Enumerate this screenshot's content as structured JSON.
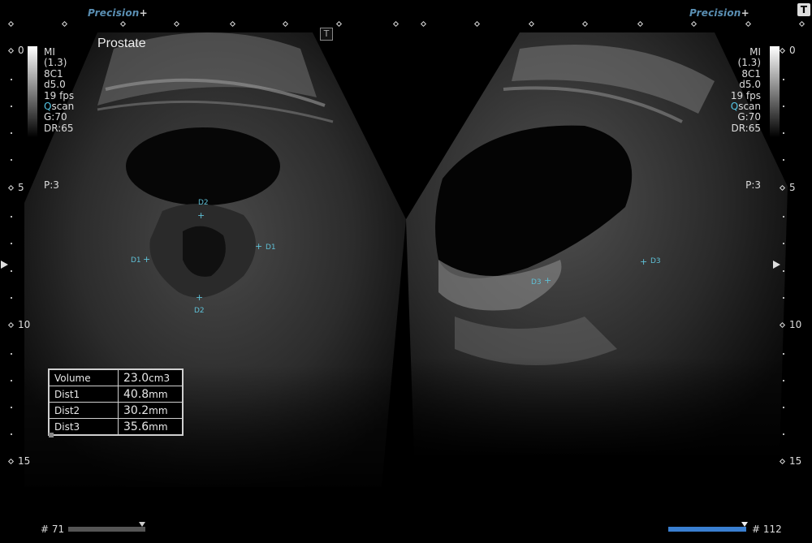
{
  "brand": {
    "left": "Precision",
    "right": "Precision",
    "plus": "+"
  },
  "exam_label": "Prostate",
  "t_icon": "T",
  "params_left": {
    "mi": "MI",
    "mi_val": "(1.3)",
    "probe": "8C1",
    "depth": "d5.0",
    "fps": "19 fps",
    "q": "Q",
    "scan": "scan",
    "gain": "G:70",
    "dr": "DR:65",
    "p": "P:3"
  },
  "params_right": {
    "mi": "MI",
    "mi_val": "(1.3)",
    "probe": "8C1",
    "depth": "d5.0",
    "fps": "19 fps",
    "q": "Q",
    "scan": "scan",
    "gain": "G:70",
    "dr": "DR:65",
    "p": "P:3"
  },
  "depth_scale": {
    "d0": "0",
    "d5": "5",
    "d10": "10",
    "d15": "15"
  },
  "calipers": {
    "d1": "D1",
    "d2": "D2",
    "d3": "D3",
    "cross": "+"
  },
  "measurements": [
    {
      "label": "Volume",
      "value": "23.0",
      "unit": "cm3"
    },
    {
      "label": "Dist1",
      "value": "40.8",
      "unit": "mm"
    },
    {
      "label": "Dist2",
      "value": "30.2",
      "unit": "mm"
    },
    {
      "label": "Dist3",
      "value": "35.6",
      "unit": "mm"
    }
  ],
  "frames": {
    "left": "# 71",
    "right": "# 112",
    "left_progress": 0.0,
    "right_progress": 1.0
  },
  "colors": {
    "accent": "#5fc0d6",
    "brand": "#5a8fb3",
    "progress": "#3a7fd0"
  }
}
